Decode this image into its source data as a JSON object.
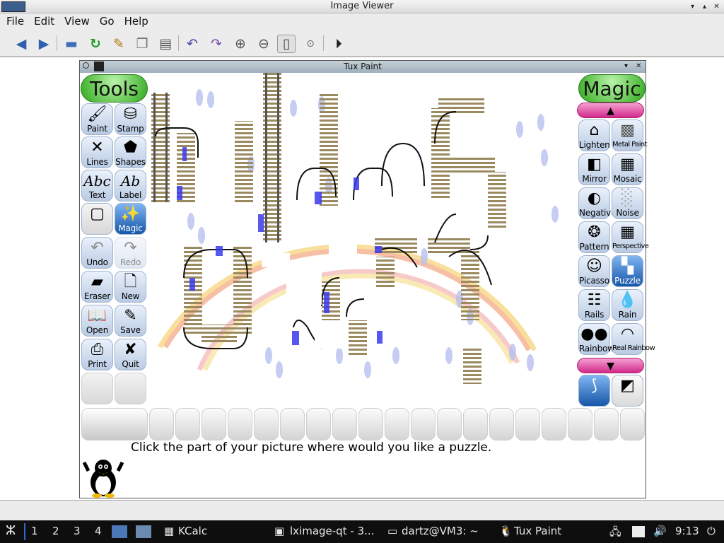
{
  "window": {
    "title": "Image Viewer"
  },
  "menu": [
    "File",
    "Edit",
    "View",
    "Go",
    "Help"
  ],
  "toolbar_icons": [
    "back-arrow-icon",
    "forward-arrow-icon",
    "open-folder-icon",
    "reload-icon",
    "edit-icon",
    "copy-icon",
    "paste-icon",
    "rotate-ccw-icon",
    "rotate-cw-icon",
    "zoom-in-icon",
    "zoom-out-icon",
    "fit-icon",
    "original-size-icon",
    "slideshow-icon"
  ],
  "tuxpaint": {
    "title": "Tux Paint",
    "tools_header": "Tools",
    "magic_header": "Magic",
    "tools": [
      {
        "label": "Paint",
        "icon": "brush-icon"
      },
      {
        "label": "Stamp",
        "icon": "stamp-icon"
      },
      {
        "label": "Lines",
        "icon": "lines-icon"
      },
      {
        "label": "Shapes",
        "icon": "pentagon-icon"
      },
      {
        "label": "Text",
        "icon": "text-icon",
        "glyph": "Abc"
      },
      {
        "label": "Label",
        "icon": "label-icon",
        "glyph": "Ab"
      },
      {
        "label": "",
        "icon": "blank-icon"
      },
      {
        "label": "Magic",
        "icon": "magic-wand-icon"
      },
      {
        "label": "Undo",
        "icon": "undo-icon"
      },
      {
        "label": "Redo",
        "icon": "redo-icon"
      },
      {
        "label": "Eraser",
        "icon": "eraser-icon"
      },
      {
        "label": "New",
        "icon": "new-document-icon"
      },
      {
        "label": "Open",
        "icon": "open-book-icon"
      },
      {
        "label": "Save",
        "icon": "save-icon"
      },
      {
        "label": "Print",
        "icon": "printer-icon"
      },
      {
        "label": "Quit",
        "icon": "quit-icon"
      }
    ],
    "magic": [
      {
        "label": "Lighten",
        "icon": "house-icon"
      },
      {
        "label": "Metal Paint",
        "icon": "metal-icon"
      },
      {
        "label": "Mirror",
        "icon": "mirror-icon"
      },
      {
        "label": "Mosaic",
        "icon": "mosaic-icon"
      },
      {
        "label": "Negative",
        "icon": "negative-icon"
      },
      {
        "label": "Noise",
        "icon": "noise-icon"
      },
      {
        "label": "Pattern",
        "icon": "pattern-icon"
      },
      {
        "label": "Perspective",
        "icon": "perspective-icon"
      },
      {
        "label": "Picasso",
        "icon": "picasso-icon"
      },
      {
        "label": "Puzzle",
        "icon": "puzzle-icon"
      },
      {
        "label": "Rails",
        "icon": "rails-icon"
      },
      {
        "label": "Rain",
        "icon": "rain-icon"
      },
      {
        "label": "Rainbow",
        "icon": "rainbow-icon"
      },
      {
        "label": "Real Rainbow",
        "icon": "real-rainbow-icon"
      }
    ],
    "message": "Click the part of your picture where would you like a puzzle."
  },
  "taskbar": {
    "workspaces": [
      "1",
      "2",
      "3",
      "4"
    ],
    "tasks": [
      {
        "label": "KCalc",
        "icon": "calculator-icon"
      },
      {
        "label": "lximage-qt - 3...",
        "icon": "image-viewer-icon"
      },
      {
        "label": "dartz@VM3: ~",
        "icon": "terminal-icon"
      },
      {
        "label": "Tux Paint",
        "icon": "tuxpaint-icon"
      }
    ],
    "clock": "9:13"
  },
  "colors": {
    "selected": "#1656a8",
    "header": "#2fa81b",
    "pink": "#d12a8a"
  }
}
